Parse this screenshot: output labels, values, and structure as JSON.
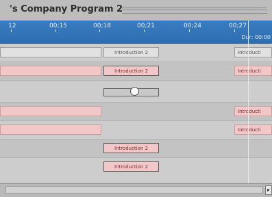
{
  "window": {
    "title": "'s Company Program 2"
  },
  "ruler": {
    "labels": [
      "12",
      "00;15",
      "00;18",
      "00;21",
      "00;24",
      "00;27"
    ],
    "duration": "Dur: 00:00"
  },
  "tracks": [
    {
      "clips": [
        {
          "kind": "gray",
          "label": ""
        },
        {
          "kind": "gray",
          "label": "Introduction 2"
        },
        {
          "kind": "gray",
          "label": "Introducti"
        }
      ]
    },
    {
      "clips": [
        {
          "kind": "pink",
          "label": ""
        },
        {
          "kind": "outlined",
          "label": "Introduction 2"
        },
        {
          "kind": "pink",
          "label": "Introducti"
        }
      ]
    },
    {
      "transition": true
    },
    {
      "clips": [
        {
          "kind": "pink",
          "label": ""
        },
        {
          "kind": "pink",
          "label": "Introducti"
        }
      ]
    },
    {
      "clips": [
        {
          "kind": "pink",
          "label": ""
        },
        {
          "kind": "pink",
          "label": "Introducti"
        }
      ]
    },
    {
      "clips": [
        {
          "kind": "outlined",
          "label": "Introduction 2"
        }
      ]
    },
    {
      "clips": [
        {
          "kind": "outlined",
          "label": "Introduction 2"
        }
      ]
    }
  ],
  "scrollbar": {
    "arrow_right": "▸"
  }
}
